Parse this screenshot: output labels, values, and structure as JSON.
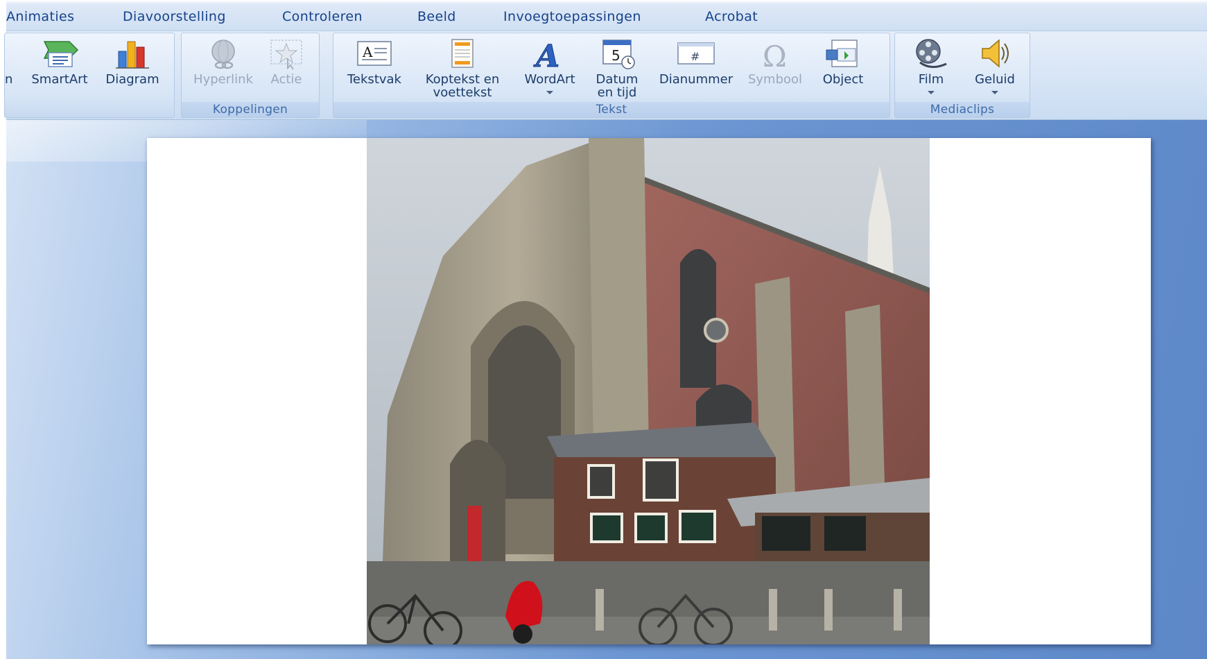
{
  "tabs": [
    "Animaties",
    "Diavoorstelling",
    "Controleren",
    "Beeld",
    "Invoegtoepassingen",
    "Acrobat"
  ],
  "ribbon": {
    "partial_button_label": "n",
    "illustrations": {
      "smartart_label": "SmartArt",
      "diagram_label": "Diagram"
    },
    "links": {
      "group_label": "Koppelingen",
      "hyperlink_label": "Hyperlink",
      "action_label": "Actie"
    },
    "text": {
      "group_label": "Tekst",
      "textbox_label": "Tekstvak",
      "header_footer_line1": "Koptekst en",
      "header_footer_line2": "voettekst",
      "wordart_label": "WordArt",
      "datetime_line1": "Datum",
      "datetime_line2": "en tijd",
      "slide_number_label": "Dianummer",
      "symbol_label": "Symbool",
      "object_label": "Object"
    },
    "media": {
      "group_label": "Mediaclips",
      "movie_label": "Film",
      "sound_label": "Geluid"
    }
  },
  "icons": {
    "smartart": "smartart-icon",
    "diagram": "bar-chart-icon",
    "hyperlink": "globe-link-icon",
    "action": "action-star-icon",
    "textbox": "textbox-icon",
    "header_footer": "document-icon",
    "wordart": "wordart-icon",
    "datetime": "calendar-clock-icon",
    "slide_number": "slide-number-icon",
    "symbol": "omega-icon",
    "object": "object-icon",
    "movie": "film-reel-icon",
    "sound": "speaker-icon"
  },
  "colors": {
    "tab_text": "#15428b",
    "ribbon_label": "#1c3c6a",
    "group_label": "#3e6aaa",
    "workspace": "#6c96d2"
  }
}
